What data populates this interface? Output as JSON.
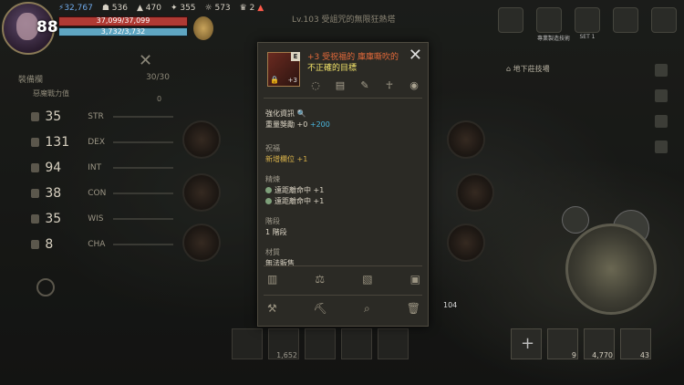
{
  "hud": {
    "level": "88",
    "hp": "37,099/37,099",
    "mp": "3,732/3,732",
    "hp_ratio": 1.0,
    "mp_ratio": 1.0,
    "crystals": "32,767",
    "stat1": "536",
    "stat2": "470",
    "stat3": "355",
    "stat4": "573",
    "stat5": "2",
    "zone_title": "Lv.103 受詛咒的無限狂熱塔",
    "top_buttons": [
      {
        "label": ""
      },
      {
        "label": "專業製造技術"
      },
      {
        "label": "SET 1"
      },
      {
        "label": ""
      },
      {
        "label": ""
      }
    ]
  },
  "left_panel": {
    "header": "裝備欄",
    "count": "30/30",
    "sub": "惡魔戰力值",
    "sub_val": "0",
    "stats": [
      {
        "value": "35",
        "name": "STR"
      },
      {
        "value": "131",
        "name": "DEX"
      },
      {
        "value": "94",
        "name": "INT"
      },
      {
        "value": "38",
        "name": "CON"
      },
      {
        "value": "35",
        "name": "WIS"
      },
      {
        "value": "8",
        "name": "CHA"
      }
    ]
  },
  "right_panel": {
    "zone": "地下莊技場"
  },
  "hotbar": {
    "counts": [
      "",
      "1,652",
      "",
      "",
      "",
      "104",
      "",
      "9",
      "4,770",
      "43"
    ]
  },
  "item": {
    "grade": "E",
    "enchant": "+3",
    "name_line1": "+3 受祝福的 庫庫嘶吹的",
    "name_line2": "不正確的目標",
    "enhance_header": "強化資訊",
    "weight_label": "重量獎勵",
    "weight_base": "+0",
    "weight_bonus": "+200",
    "bless_header": "祝福",
    "bless_value": "新增欄位 +1",
    "special_header": "精煉",
    "special_lines": [
      "遠距離命中 +1",
      "遠距離命中 +1"
    ],
    "stage_header": "階段",
    "stage_value": "1 階段",
    "material_header": "材質",
    "material_value": "無法販售"
  },
  "colors": {
    "hp": "#b03a34",
    "mp": "#5fa6c2",
    "name_enchant": "#e46a3a",
    "name_title": "#f2e36a",
    "bonus": "#4ab8e0",
    "bless": "#d8b24a"
  }
}
